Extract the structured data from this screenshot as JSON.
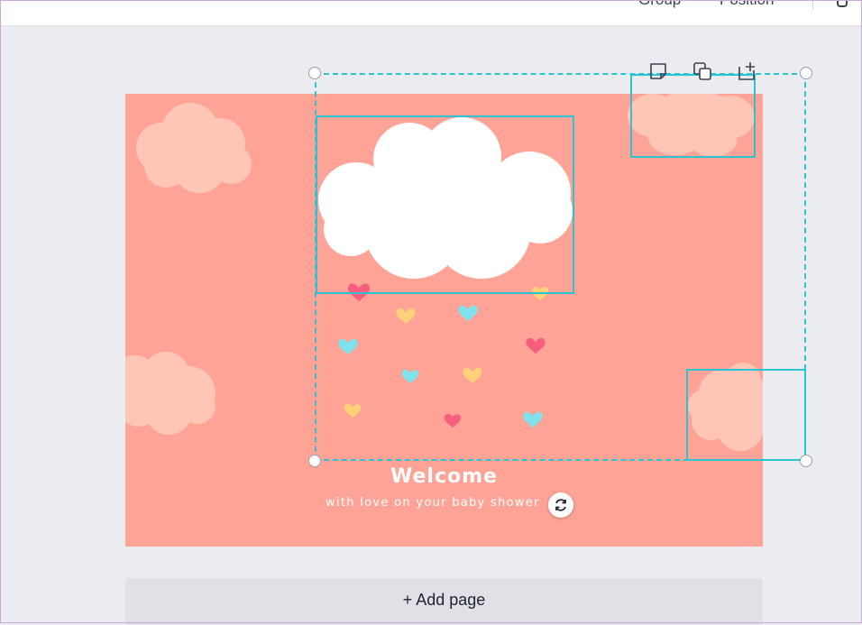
{
  "toolbar": {
    "group_label": "Group",
    "position_label": "Position"
  },
  "element_tools": {
    "comment_icon": "comment-icon",
    "duplicate_icon": "duplicate-icon",
    "add_page_icon": "add-icon"
  },
  "design": {
    "background_color": "#fea395",
    "heading": "Welcome",
    "subheading": "with love on your baby shower"
  },
  "selection": {
    "color": "#2bc4d2",
    "rotate_icon": "rotate-icon"
  },
  "add_page": {
    "label": "+ Add page"
  }
}
